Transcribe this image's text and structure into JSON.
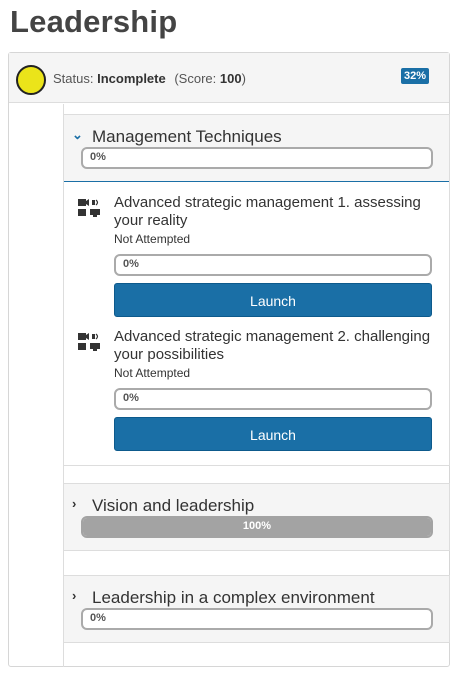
{
  "page": {
    "title": "Leadership"
  },
  "status": {
    "label": "Status:",
    "value": "Incomplete",
    "score_text": "(Score: ",
    "score_value": "100",
    "score_close": ")",
    "percent_badge": "32%",
    "indicator_color": "#ebe41a"
  },
  "sections": [
    {
      "title": "Management Techniques",
      "expanded": true,
      "progress_text": "0%",
      "progress_value": 0,
      "lessons": [
        {
          "title": "Advanced strategic management 1. assessing your reality",
          "status": "Not Attempted",
          "progress_text": "0%",
          "progress_value": 0,
          "button": "Launch",
          "icon": "multimedia-icon"
        },
        {
          "title": "Advanced strategic management 2. challenging your possibilities",
          "status": "Not Attempted",
          "progress_text": "0%",
          "progress_value": 0,
          "button": "Launch",
          "icon": "multimedia-icon"
        }
      ]
    },
    {
      "title": "Vision and leadership",
      "expanded": false,
      "progress_text": "100%",
      "progress_value": 100
    },
    {
      "title": "Leadership in a complex environment",
      "expanded": false,
      "progress_text": "0%",
      "progress_value": 0
    }
  ],
  "colors": {
    "accent": "#1a6fa6",
    "progress_fill": "#a3a3a3",
    "panel_bg": "#f5f5f5"
  }
}
